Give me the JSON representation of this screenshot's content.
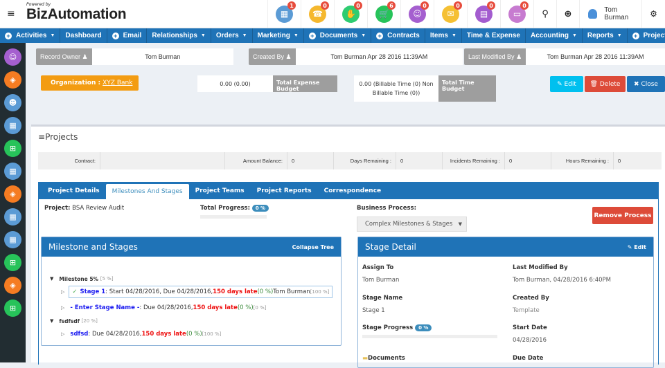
{
  "header": {
    "powered_by": "Powered by",
    "brand": "BizAutomation",
    "notification_icons": [
      {
        "name": "organizations-icon",
        "count": "1",
        "color": "#5b9bd5",
        "glyph": "▦"
      },
      {
        "name": "support-icon",
        "count": "0",
        "color": "#f5b82e",
        "glyph": "☎"
      },
      {
        "name": "handshake-icon",
        "count": "0",
        "color": "#2ecc71",
        "glyph": "✋"
      },
      {
        "name": "cart-icon",
        "count": "6",
        "color": "#27c35a",
        "glyph": "🛒"
      },
      {
        "name": "contact-icon",
        "count": "0",
        "color": "#a55fcf",
        "glyph": "☺"
      },
      {
        "name": "mail-icon",
        "count": "0",
        "color": "#f5c033",
        "glyph": "✉"
      },
      {
        "name": "calendar-icon",
        "count": "0",
        "color": "#a35ccf",
        "glyph": "▤"
      },
      {
        "name": "document-icon",
        "count": "0",
        "color": "#c77bd0",
        "glyph": "▭"
      }
    ],
    "search_glyph": "⚲",
    "zoom_glyph": "⊕",
    "user_name": "Tom Burman",
    "settings_glyph": "⚙",
    "menu_glyph": "≡"
  },
  "menu": [
    {
      "label": "Activities",
      "plus": true,
      "caret": true
    },
    {
      "label": "Dashboard",
      "plus": false,
      "caret": false
    },
    {
      "label": "Email",
      "plus": true,
      "caret": false
    },
    {
      "label": "Relationships",
      "plus": false,
      "caret": true
    },
    {
      "label": "Orders",
      "plus": false,
      "caret": true
    },
    {
      "label": "Marketing",
      "plus": false,
      "caret": true
    },
    {
      "label": "Documents",
      "plus": true,
      "caret": true
    },
    {
      "label": "Contracts",
      "plus": true,
      "caret": false
    },
    {
      "label": "Items",
      "plus": false,
      "caret": true
    },
    {
      "label": "Time & Expense",
      "plus": false,
      "caret": false
    },
    {
      "label": "Accounting",
      "plus": false,
      "caret": true
    },
    {
      "label": "Reports",
      "plus": false,
      "caret": true
    },
    {
      "label": "Projects",
      "plus": true,
      "caret": false
    }
  ],
  "sidebar": [
    {
      "name": "contacts-icon",
      "color": "#a55fcf",
      "glyph": "☺"
    },
    {
      "name": "tag-icon",
      "color": "#f57c22",
      "glyph": "◈"
    },
    {
      "name": "users-icon",
      "color": "#5b9bd5",
      "glyph": "☻"
    },
    {
      "name": "building-icon",
      "color": "#5b9bd5",
      "glyph": "▦"
    },
    {
      "name": "cart-icon",
      "color": "#27c35a",
      "glyph": "⊞"
    },
    {
      "name": "building-icon",
      "color": "#5b9bd5",
      "glyph": "▦"
    },
    {
      "name": "tag-icon",
      "color": "#f57c22",
      "glyph": "◈"
    },
    {
      "name": "building-icon",
      "color": "#5b9bd5",
      "glyph": "▦"
    },
    {
      "name": "building-icon",
      "color": "#5b9bd5",
      "glyph": "▦"
    },
    {
      "name": "cart-icon",
      "color": "#27c35a",
      "glyph": "⊞"
    },
    {
      "name": "tag-icon",
      "color": "#f57c22",
      "glyph": "◈"
    },
    {
      "name": "cart-icon",
      "color": "#27c35a",
      "glyph": "⊞"
    }
  ],
  "record": {
    "owner_label": "Record Owner",
    "owner_value": "Tom Burman",
    "created_label": "Created By",
    "created_value": "Tom Burman Apr 28 2016 11:39AM",
    "modified_label": "Last Modified By",
    "modified_value": "Tom Burman Apr 28 2016 11:39AM"
  },
  "organization": {
    "label": "Organization :",
    "value": "XYZ Bank"
  },
  "budget": {
    "expense_value": "0.00 (0.00)",
    "expense_label": "Total Expense Budget",
    "time_value": "0.00 (Billable Time (0) Non Billable Time (0))",
    "time_label": "Total Time Budget"
  },
  "actions": {
    "edit": "Edit",
    "delete": "Delete",
    "close": "Close"
  },
  "projects": {
    "title": "Projects",
    "stats": {
      "contract_label": "Contract:",
      "contract_value": "",
      "amount_label": "Amount Balance:",
      "amount_value": "0",
      "days_label": "Days Remaining :",
      "days_value": "0",
      "incidents_label": "Incidents Remaining :",
      "incidents_value": "0",
      "hours_label": "Hours Remaining :",
      "hours_value": "0"
    },
    "tabs": [
      "Project Details",
      "Milestones And Stages",
      "Project Teams",
      "Project Reports",
      "Correspondence"
    ],
    "active_tab": 1
  },
  "milestones": {
    "project_label": "Project:",
    "project_value": "BSA Review Audit",
    "total_progress_label": "Total Progress:",
    "total_progress": "0 %",
    "business_process_label": "Business Process:",
    "business_process_value": "Complex Milestones & Stages",
    "remove_process": "Remove Process",
    "tree_title": "Milestone and Stages",
    "collapse_tree": "Collapse Tree",
    "tree": {
      "m1_name": "Milestone 5%",
      "m1_pct": "[5 %]",
      "s1_name": "Stage 1",
      "s1_text": " : Start 04/28/2016, Due 04/28/2016, ",
      "s1_late": "150 days late",
      "s1_progress": " (0 %)",
      "s1_owner": " Tom Burman ",
      "s1_pct": "[100 %]",
      "s2_name": "- Enter Stage Name -",
      "s2_text": " : Due 04/28/2016, ",
      "s2_late": "150 days late",
      "s2_progress": " (0 %)",
      "s2_pct": " [0 %]",
      "m2_name": "fsdfsdf",
      "m2_pct": "[20 %]",
      "s3_name": "sdfsd",
      "s3_text": " : Due 04/28/2016, ",
      "s3_late": "150 days late",
      "s3_progress": " (0 %)",
      "s3_pct": " [100 %]"
    },
    "stage_detail": {
      "title": "Stage Detail",
      "edit": "Edit",
      "assign_to_label": "Assign To",
      "assign_to_value": "Tom Burman",
      "last_modified_label": "Last Modified By",
      "last_modified_value": "Tom Burman, 04/28/2016 6:40PM",
      "stage_name_label": "Stage Name",
      "stage_name_value": "Stage 1",
      "created_by_label": "Created By",
      "created_by_value": "Template",
      "stage_progress_label": "Stage Progress",
      "stage_progress": "0 %",
      "start_date_label": "Start Date",
      "start_date_value": "04/28/2016",
      "documents_label": "Documents",
      "due_date_label": "Due Date"
    }
  }
}
